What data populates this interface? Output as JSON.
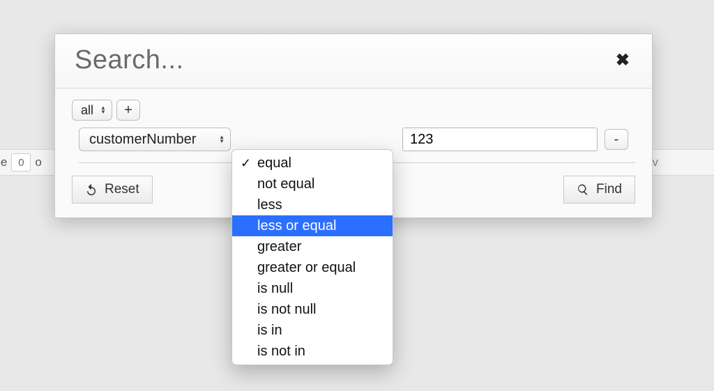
{
  "background": {
    "page_label_left": "age",
    "page_value": "0",
    "page_label_mid": "o"
  },
  "dialog": {
    "title": "Search...",
    "match_select": "all",
    "plus_label": "+",
    "rule": {
      "field": "customerNumber",
      "value": "123",
      "minus_label": "-"
    },
    "reset_label": "Reset",
    "find_label": "Find"
  },
  "operator_dropdown": {
    "items": [
      {
        "label": "equal",
        "checked": true,
        "highlighted": false
      },
      {
        "label": "not equal",
        "checked": false,
        "highlighted": false
      },
      {
        "label": "less",
        "checked": false,
        "highlighted": false
      },
      {
        "label": "less or equal",
        "checked": false,
        "highlighted": true
      },
      {
        "label": "greater",
        "checked": false,
        "highlighted": false
      },
      {
        "label": "greater or equal",
        "checked": false,
        "highlighted": false
      },
      {
        "label": "is null",
        "checked": false,
        "highlighted": false
      },
      {
        "label": "is not null",
        "checked": false,
        "highlighted": false
      },
      {
        "label": "is in",
        "checked": false,
        "highlighted": false
      },
      {
        "label": "is not in",
        "checked": false,
        "highlighted": false
      }
    ]
  }
}
